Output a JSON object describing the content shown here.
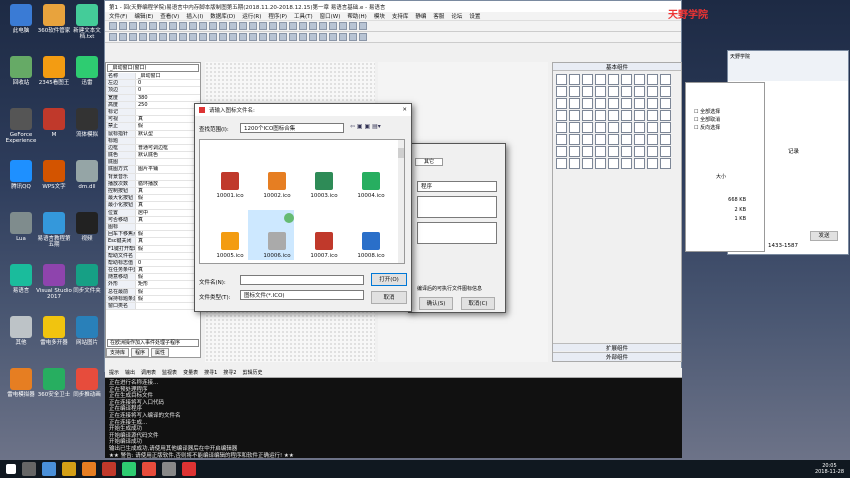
{
  "desktop": {
    "icons": [
      "此电脑",
      "360软件管家",
      "新建文本文档.txt",
      "回收站",
      "2345看图王",
      "迅雷",
      "GeForce Experience",
      "M",
      "流体模拟",
      "腾讯QQ",
      "WPS文字",
      "dm.dll",
      "Lua",
      "易语言教程第五期",
      "视频",
      "易语言",
      "Visual Studio 2017",
      "同步文件夹",
      "其他",
      "雷电多开器",
      "网站图片",
      "雷电模拟器",
      "360安全卫士",
      "同步推动画"
    ]
  },
  "ide": {
    "title": "第1 - 回(天野编程学院)易语言中内存脚本版制图第五期(2018.11.20-2018.12.15)第一章 易语言基础.e - 易语言",
    "menu": [
      "文件(F)",
      "编辑(E)",
      "查看(V)",
      "插入(I)",
      "数据库(D)",
      "运行(R)",
      "程序(P)",
      "工具(T)",
      "窗口(W)",
      "帮助(H)",
      "模块",
      "支持库",
      "静编",
      "客服",
      "论坛",
      "设置"
    ],
    "props_title": "_启动窗口(窗口)",
    "props": [
      [
        "名称",
        "_启动窗口"
      ],
      [
        "左边",
        "0"
      ],
      [
        "顶边",
        "0"
      ],
      [
        "宽度",
        "380"
      ],
      [
        "高度",
        "250"
      ],
      [
        "标记",
        ""
      ],
      [
        "可视",
        "真"
      ],
      [
        "禁止",
        "假"
      ],
      [
        "鼠标指针",
        "默认型"
      ],
      [
        "标题",
        ""
      ],
      [
        "边框",
        "普通可调边框"
      ],
      [
        "底色",
        "默认底色"
      ],
      [
        "底图",
        ""
      ],
      [
        "底图方式",
        "图片平铺"
      ],
      [
        "背景音乐",
        ""
      ],
      [
        "播放次数",
        "循环播放"
      ],
      [
        "控制按钮",
        "真"
      ],
      [
        "最大化按钮",
        "假"
      ],
      [
        "最小化按钮",
        "真"
      ],
      [
        "位置",
        "居中"
      ],
      [
        "可否移动",
        "真"
      ],
      [
        "图标",
        ""
      ],
      [
        "回车下移焦点",
        "假"
      ],
      [
        "Esc键关闭",
        "真"
      ],
      [
        "F1键打开帮助",
        "假"
      ],
      [
        "帮助文件名",
        ""
      ],
      [
        "帮助标志值",
        "0"
      ],
      [
        "在任务条中显示",
        "真"
      ],
      [
        "随意移动",
        "假"
      ],
      [
        "外形",
        "矩形"
      ],
      [
        "总在最前",
        "假"
      ],
      [
        "保持标题条激活",
        "假"
      ],
      [
        "窗口类名",
        ""
      ]
    ],
    "props_footer": "在欧洲操作加入事件处理子程序",
    "left_tabs": [
      "支持库",
      "程序",
      "属性"
    ],
    "comp_title": "基本组件",
    "comp_bottom": [
      "扩展组件",
      "外部组件"
    ],
    "out_tabs": [
      "提示",
      "输出",
      "调用表",
      "监视表",
      "变量表",
      "搜寻1",
      "搜寻2",
      "剪辑历史"
    ],
    "out_lines": [
      "正在进行名称连接...",
      "正在预处理程序",
      "正在生成目标文件",
      "正在连接将写入口代码",
      "正在编译程序",
      "正在连接将写入编译的文件名",
      "正在连接生成...",
      "开始生成成功",
      "开始编译源代码文件",
      "开始编译成功",
      "输出已生成成功,请使用其他编译器后在中开启编辑器",
      "★★ 警告: 请使用正版软件,否则将不能编译编辑的程序和软件正确运行! ★★"
    ]
  },
  "dlg": {
    "title": "请输入图标文件名:",
    "lookin_label": "查找范围(I):",
    "lookin_value": "1200个ICO图标合集",
    "files": [
      "10001.ico",
      "10002.ico",
      "10003.ico",
      "10004.ico",
      "10005.ico",
      "10006.ico",
      "10007.ico",
      "10008.ico"
    ],
    "filename_label": "文件名(N):",
    "filename_value": "",
    "filetype_label": "文件类型(T):",
    "filetype_value": "图标文件(*.ICO)",
    "open": "打开(O)",
    "cancel": "取消"
  },
  "dlg2": {
    "tab": "其它",
    "value1": "程序",
    "confirm": "确认(S)",
    "cancel": "取消(C)",
    "partial": "编译后的可执行文件图标信息"
  },
  "right": {
    "title": "天野学院",
    "qq": "1433-1587",
    "rec": "记录",
    "size": "大小",
    "kb": [
      "668 KB",
      "2 KB",
      "1 KB"
    ],
    "send": "发送"
  },
  "taskbar": {
    "time": "20:05",
    "date": "2018-11-28"
  }
}
